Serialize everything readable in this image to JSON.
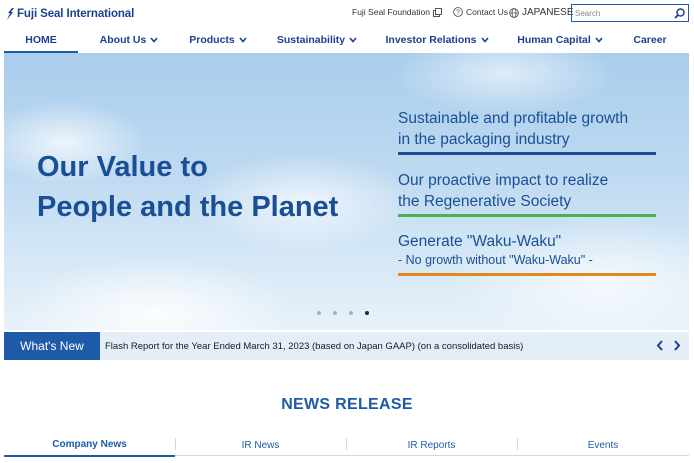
{
  "brand": {
    "name": "Fuji Seal International",
    "color": "#1d3f8f"
  },
  "utility": {
    "foundation_label": "Fuji Seal Foundation",
    "contact_label": "Contact Us",
    "japanese_label": "JAPANESE",
    "search_placeholder": "Search"
  },
  "nav": {
    "home": "HOME",
    "about": "About Us",
    "products": "Products",
    "sustainability": "Sustainability",
    "investor": "Investor Relations",
    "human_capital": "Human Capital",
    "career": "Career"
  },
  "hero": {
    "title_line1": "Our Value to",
    "title_line2": "People and the Planet",
    "claim1_line1": "Sustainable and profitable growth",
    "claim1_line2": "in the packaging industry",
    "claim2_line1": "Our proactive impact to realize",
    "claim2_line2": "the Regenerative Society",
    "claim3_line1": "Generate \"Waku-Waku\"",
    "claim3_line2": "- No growth without \"Waku-Waku\" -",
    "slide_count": 4,
    "active_slide": 4
  },
  "whats_new": {
    "label": "What's New",
    "text": "Flash Report for the Year Ended March 31, 2023 (based on Japan GAAP) (on a consolidated basis)"
  },
  "news_release": {
    "title": "NEWS RELEASE",
    "tabs": [
      "Company News",
      "IR News",
      "IR Reports",
      "Events"
    ],
    "active_tab": 0
  },
  "colors": {
    "primary": "#1e5aa8",
    "claim1_rule": "#1b4f95",
    "claim2_rule": "#4caf50",
    "claim3_rule": "#e08a1e"
  }
}
